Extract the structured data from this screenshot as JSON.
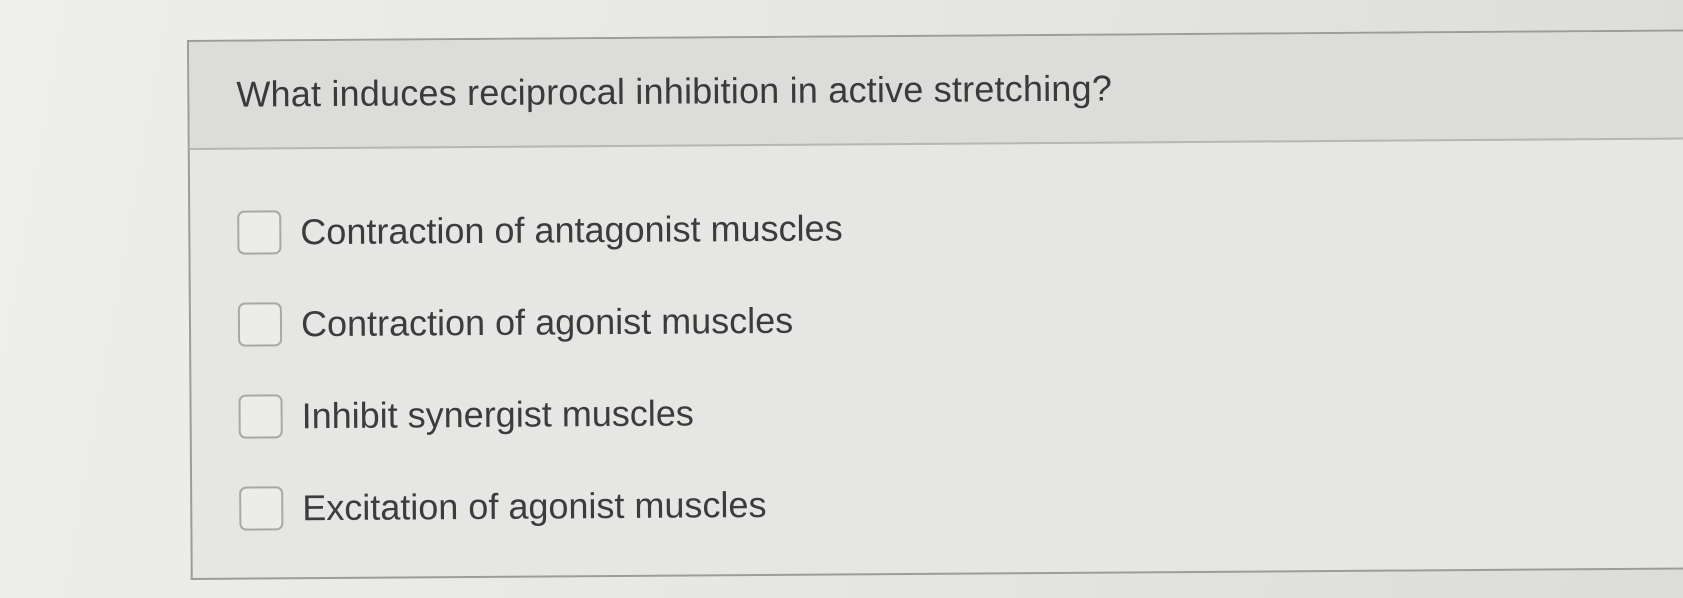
{
  "question": {
    "text": "What induces reciprocal inhibition in active stretching?"
  },
  "options": [
    {
      "label": "Contraction of antagonist muscles",
      "checked": false
    },
    {
      "label": "Contraction of agonist muscles",
      "checked": false
    },
    {
      "label": "Inhibit synergist muscles",
      "checked": false
    },
    {
      "label": "Excitation of agonist muscles",
      "checked": false
    }
  ]
}
